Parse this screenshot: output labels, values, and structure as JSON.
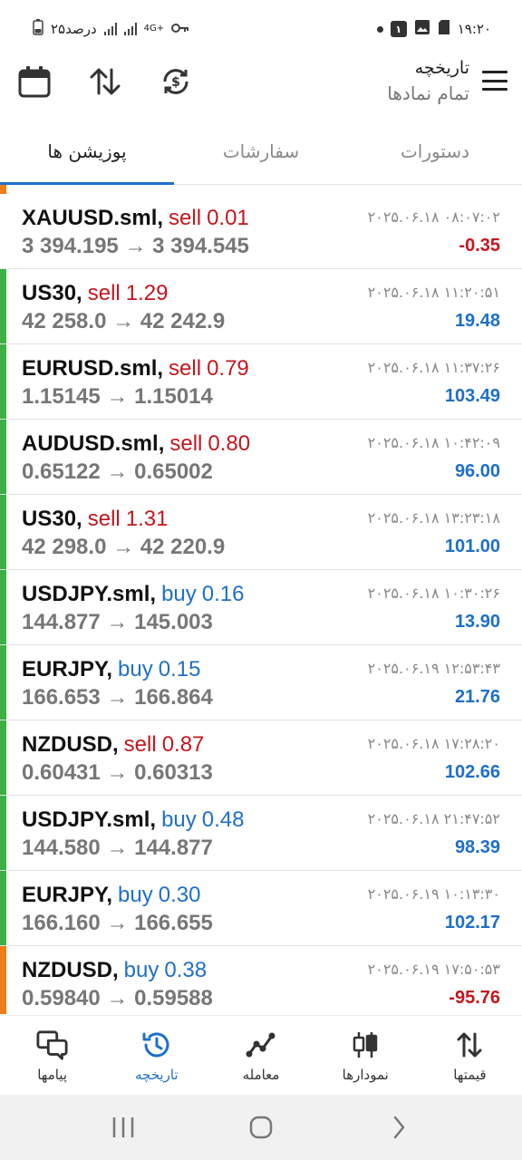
{
  "status_bar": {
    "time": "۱۹:۲۰",
    "battery_text": "۲۵درصد",
    "network": "4G+"
  },
  "header": {
    "title": "تاریخچه",
    "subtitle": "تمام نمادها"
  },
  "tabs": [
    {
      "label": "دستورات",
      "active": false
    },
    {
      "label": "سفارشات",
      "active": false
    },
    {
      "label": "پوزیشن ها",
      "active": true
    }
  ],
  "colors": {
    "sell": "#c4161c",
    "buy": "#1e6fc9",
    "profit_positive": "#1e6fc9",
    "profit_negative": "#c4161c",
    "edge_green": "#3cb043",
    "edge_orange": "#ef7d1a"
  },
  "positions": [
    {
      "symbol": "XAUUSD.sml",
      "side": "sell",
      "volume": "0.01",
      "open": "3 394.195",
      "close": "3 394.545",
      "time": "۲۰۲۵.۰۶.۱۸ ۰۸:۰۷:۰۲",
      "profit": "-0.35",
      "edge": "none"
    },
    {
      "symbol": "US30",
      "side": "sell",
      "volume": "1.29",
      "open": "42 258.0",
      "close": "42 242.9",
      "time": "۲۰۲۵.۰۶.۱۸ ۱۱:۲۰:۵۱",
      "profit": "19.48",
      "edge": "green"
    },
    {
      "symbol": "EURUSD.sml",
      "side": "sell",
      "volume": "0.79",
      "open": "1.15145",
      "close": "1.15014",
      "time": "۲۰۲۵.۰۶.۱۸ ۱۱:۳۷:۲۶",
      "profit": "103.49",
      "edge": "green"
    },
    {
      "symbol": "AUDUSD.sml",
      "side": "sell",
      "volume": "0.80",
      "open": "0.65122",
      "close": "0.65002",
      "time": "۲۰۲۵.۰۶.۱۸ ۱۰:۴۲:۰۹",
      "profit": "96.00",
      "edge": "green"
    },
    {
      "symbol": "US30",
      "side": "sell",
      "volume": "1.31",
      "open": "42 298.0",
      "close": "42 220.9",
      "time": "۲۰۲۵.۰۶.۱۸ ۱۳:۲۳:۱۸",
      "profit": "101.00",
      "edge": "green"
    },
    {
      "symbol": "USDJPY.sml",
      "side": "buy",
      "volume": "0.16",
      "open": "144.877",
      "close": "145.003",
      "time": "۲۰۲۵.۰۶.۱۸ ۱۰:۳۰:۲۶",
      "profit": "13.90",
      "edge": "green"
    },
    {
      "symbol": "EURJPY",
      "side": "buy",
      "volume": "0.15",
      "open": "166.653",
      "close": "166.864",
      "time": "۲۰۲۵.۰۶.۱۹ ۱۲:۵۳:۴۳",
      "profit": "21.76",
      "edge": "green"
    },
    {
      "symbol": "NZDUSD",
      "side": "sell",
      "volume": "0.87",
      "open": "0.60431",
      "close": "0.60313",
      "time": "۲۰۲۵.۰۶.۱۸ ۱۷:۲۸:۲۰",
      "profit": "102.66",
      "edge": "green"
    },
    {
      "symbol": "USDJPY.sml",
      "side": "buy",
      "volume": "0.48",
      "open": "144.580",
      "close": "144.877",
      "time": "۲۰۲۵.۰۶.۱۸ ۲۱:۴۷:۵۲",
      "profit": "98.39",
      "edge": "green"
    },
    {
      "symbol": "EURJPY",
      "side": "buy",
      "volume": "0.30",
      "open": "166.160",
      "close": "166.655",
      "time": "۲۰۲۵.۰۶.۱۹ ۱۰:۱۳:۳۰",
      "profit": "102.17",
      "edge": "green"
    },
    {
      "symbol": "NZDUSD",
      "side": "buy",
      "volume": "0.38",
      "open": "0.59840",
      "close": "0.59588",
      "time": "۲۰۲۵.۰۶.۱۹ ۱۷:۵۰:۵۳",
      "profit": "-95.76",
      "edge": "orange"
    }
  ],
  "bottom_nav": [
    {
      "label": "قیمتها",
      "icon": "arrows-up-down-icon",
      "active": false
    },
    {
      "label": "نمودارها",
      "icon": "candlestick-icon",
      "active": false
    },
    {
      "label": "معامله",
      "icon": "trade-line-icon",
      "active": false
    },
    {
      "label": "تاریخچه",
      "icon": "history-clock-icon",
      "active": true
    },
    {
      "label": "پیامها",
      "icon": "chat-icon",
      "active": false
    }
  ]
}
